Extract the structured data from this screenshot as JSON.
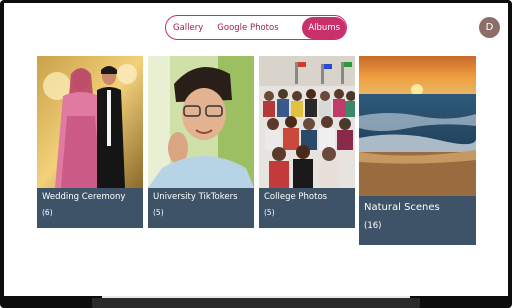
{
  "tabs": {
    "gallery": "Gallery",
    "google_photos": "Google Photos",
    "albums": "Albums"
  },
  "profile": {
    "initial": "D"
  },
  "albums": [
    {
      "title": "Wedding Ceremony",
      "count": "(6)"
    },
    {
      "title": "University TikTokers",
      "count": "(5)"
    },
    {
      "title": "College Photos",
      "count": "(5)"
    },
    {
      "title": "Natural Scenes",
      "count": "(16)"
    }
  ],
  "colors": {
    "accent": "#c8306b",
    "caption_bg": "#3e5367",
    "avatar_bg": "#8c6e68"
  }
}
